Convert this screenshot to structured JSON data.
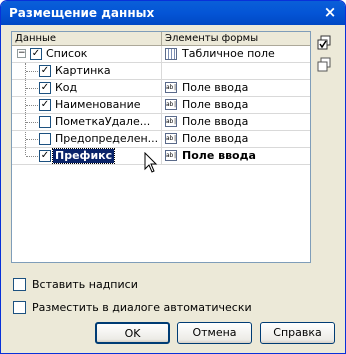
{
  "window": {
    "title": "Размещение данных",
    "close_glyph": "×"
  },
  "tree": {
    "headers": [
      "Данные",
      "Элементы формы"
    ],
    "rows": [
      {
        "label": "Список",
        "checked": true,
        "expander": "−",
        "element": "Табличное поле",
        "element_icon": "table-icon",
        "selected": false
      },
      {
        "label": "Картинка",
        "checked": true,
        "element": "",
        "element_icon": "",
        "selected": false
      },
      {
        "label": "Код",
        "checked": true,
        "element": "Поле ввода",
        "element_icon": "input-field-icon",
        "selected": false
      },
      {
        "label": "Наименование",
        "checked": true,
        "element": "Поле ввода",
        "element_icon": "input-field-icon",
        "selected": false
      },
      {
        "label": "ПометкаУдале...",
        "checked": false,
        "element": "Поле ввода",
        "element_icon": "input-field-icon",
        "selected": false
      },
      {
        "label": "Предопределен...",
        "checked": false,
        "element": "Поле ввода",
        "element_icon": "input-field-icon",
        "selected": false
      },
      {
        "label": "Префикс",
        "checked": true,
        "element": "Поле ввода",
        "element_icon": "input-field-icon",
        "selected": true
      }
    ],
    "input_icon_text": "ab|",
    "check_glyph": "✓"
  },
  "side_icons": [
    "check-all-icon",
    "uncheck-all-icon"
  ],
  "options": {
    "insert_captions": "Вставить надписи",
    "auto_place": "Разместить в диалоге автоматически"
  },
  "buttons": {
    "ok": "OK",
    "cancel": "Отмена",
    "help": "Справка"
  },
  "colors": {
    "title_bar": "#0455d6",
    "dialog_bg": "#ece9d8",
    "selection": "#0a246a"
  }
}
